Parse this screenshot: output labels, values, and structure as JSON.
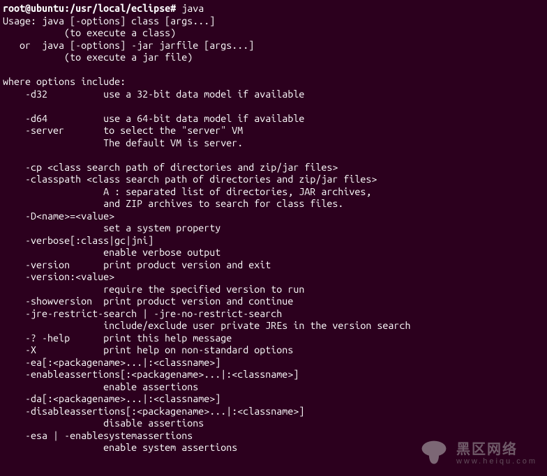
{
  "prompt_user": "root@ubuntu",
  "prompt_sep1": ":",
  "prompt_path": "/usr/local/eclipse",
  "prompt_sep2": "#",
  "command": " java",
  "lines": [
    "Usage: java [-options] class [args...]",
    "           (to execute a class)",
    "   or  java [-options] -jar jarfile [args...]",
    "           (to execute a jar file)",
    "",
    "where options include:",
    "    -d32          use a 32-bit data model if available",
    "",
    "    -d64          use a 64-bit data model if available",
    "    -server       to select the \"server\" VM",
    "                  The default VM is server.",
    "",
    "    -cp <class search path of directories and zip/jar files>",
    "    -classpath <class search path of directories and zip/jar files>",
    "                  A : separated list of directories, JAR archives,",
    "                  and ZIP archives to search for class files.",
    "    -D<name>=<value>",
    "                  set a system property",
    "    -verbose[:class|gc|jni]",
    "                  enable verbose output",
    "    -version      print product version and exit",
    "    -version:<value>",
    "                  require the specified version to run",
    "    -showversion  print product version and continue",
    "    -jre-restrict-search | -jre-no-restrict-search",
    "                  include/exclude user private JREs in the version search",
    "    -? -help      print this help message",
    "    -X            print help on non-standard options",
    "    -ea[:<packagename>...|:<classname>]",
    "    -enableassertions[:<packagename>...|:<classname>]",
    "                  enable assertions",
    "    -da[:<packagename>...|:<classname>]",
    "    -disableassertions[:<packagename>...|:<classname>]",
    "                  disable assertions",
    "    -esa | -enablesystemassertions",
    "                  enable system assertions"
  ],
  "watermark": {
    "title": "黑区网络",
    "domain": "www.heiqu.com"
  }
}
